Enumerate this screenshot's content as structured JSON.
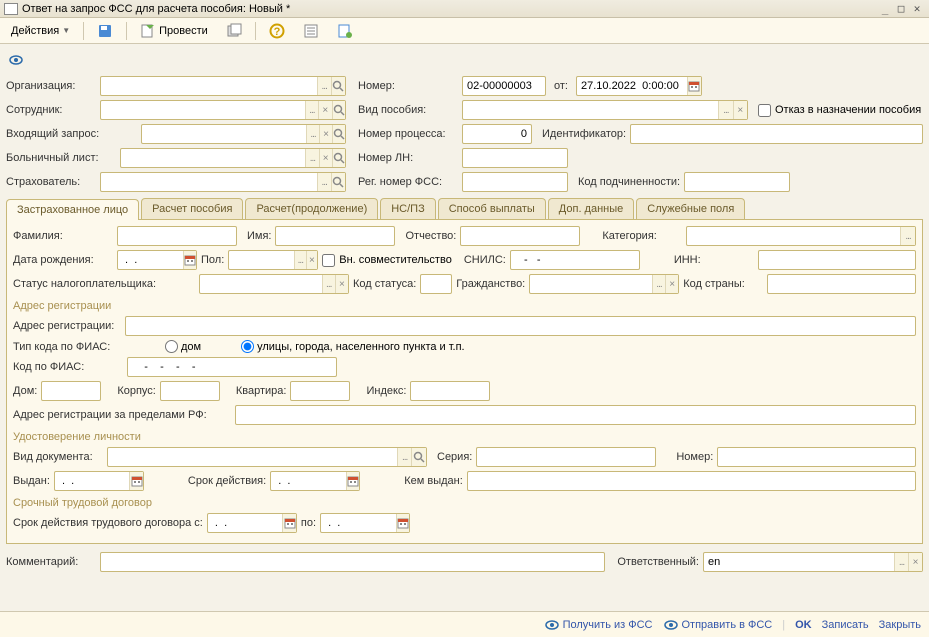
{
  "window": {
    "title": "Ответ на запрос ФСС для расчета пособия: Новый *"
  },
  "toolbar": {
    "actions": "Действия",
    "run": "Провести"
  },
  "header": {
    "org_label": "Организация:",
    "emp_label": "Сотрудник:",
    "inreq_label": "Входящий запрос:",
    "sick_label": "Больничный лист:",
    "insurer_label": "Страхователь:",
    "number_label": "Номер:",
    "number_value": "02-00000003",
    "date_label": "от:",
    "date_value": "27.10.2022  0:00:00",
    "benefit_label": "Вид пособия:",
    "refuse_label": "Отказ в назначении пособия",
    "process_label": "Номер процесса:",
    "process_value": "0",
    "ident_label": "Идентификатор:",
    "ln_label": "Номер ЛН:",
    "fssreg_label": "Рег. номер ФСС:",
    "subcode_label": "Код подчиненности:"
  },
  "tabs": [
    "Застрахованное лицо",
    "Расчет пособия",
    "Расчет(продолжение)",
    "НС/ПЗ",
    "Способ выплаты",
    "Доп. данные",
    "Служебные поля"
  ],
  "person": {
    "surname_label": "Фамилия:",
    "name_label": "Имя:",
    "patr_label": "Отчество:",
    "cat_label": "Категория:",
    "dob_label": "Дата рождения:",
    "dob_value": " .  .    ",
    "gender_label": "Пол:",
    "ext_label": "Вн. совместительство",
    "snils_label": "СНИЛС:",
    "snils_value": "   -   -      ",
    "inn_label": "ИНН:",
    "tax_label": "Статус налогоплательщика:",
    "taxcode_label": "Код статуса:",
    "citizen_label": "Гражданство:",
    "country_label": "Код страны:"
  },
  "address": {
    "title": "Адрес регистрации",
    "addr_label": "Адрес регистрации:",
    "fias_type_label": "Тип кода по ФИАС:",
    "radio_house": "дом",
    "radio_street": "улицы, города, населенного пункта  и т.п.",
    "fias_code_label": "Код по ФИАС:",
    "fias_code_value": "    -    -    -    -    ",
    "house_label": "Дом:",
    "korpus_label": "Корпус:",
    "flat_label": "Квартира:",
    "index_label": "Индекс:",
    "abroad_label": "Адрес регистрации за пределами РФ:"
  },
  "idcard": {
    "title": "Удостоверение личности",
    "doctype_label": "Вид документа:",
    "series_label": "Серия:",
    "num_label": "Номер:",
    "issued_label": "Выдан:",
    "issued_value": " .  .    ",
    "valid_label": "Срок действия:",
    "valid_value": " .  .    ",
    "by_label": "Кем выдан:"
  },
  "contract": {
    "title": "Срочный трудовой договор",
    "from_label": "Срок действия трудового договора с:",
    "from_value": " .  .    ",
    "to_label": "по:",
    "to_value": " .  .    "
  },
  "footer": {
    "comment_label": "Комментарий:",
    "resp_label": "Ответственный:",
    "resp_value": "en"
  },
  "bottom": {
    "get": "Получить из ФСС",
    "send": "Отправить в ФСС",
    "ok": "OK",
    "save": "Записать",
    "close": "Закрыть"
  }
}
